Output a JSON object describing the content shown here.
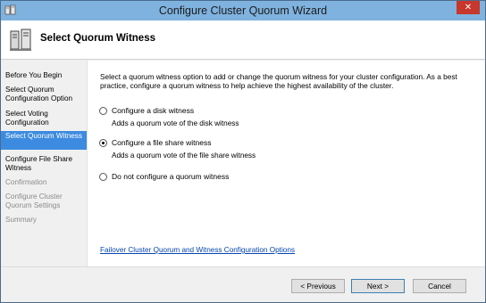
{
  "window": {
    "title": "Configure Cluster Quorum Wizard",
    "close_glyph": "✕"
  },
  "header": {
    "title": "Select Quorum Witness"
  },
  "sidebar": {
    "steps": [
      {
        "label": "Before You Begin",
        "state": "normal"
      },
      {
        "label": "Select Quorum Configuration Option",
        "state": "normal"
      },
      {
        "label": "Select Voting Configuration",
        "state": "normal"
      },
      {
        "label": "Select Quorum Witness",
        "state": "active"
      },
      {
        "label": "Configure File Share Witness",
        "state": "normal"
      },
      {
        "label": "Confirmation",
        "state": "disabled"
      },
      {
        "label": "Configure Cluster Quorum Settings",
        "state": "disabled"
      },
      {
        "label": "Summary",
        "state": "disabled"
      }
    ]
  },
  "main": {
    "intro": "Select a quorum witness option to add or change the quorum witness for your cluster configuration. As a best practice, configure a quorum witness to help achieve the highest availability of the cluster.",
    "options": [
      {
        "label": "Configure a disk witness",
        "description": "Adds a quorum vote of the disk witness",
        "checked": false
      },
      {
        "label": "Configure a file share witness",
        "description": "Adds a quorum vote of the file share witness",
        "checked": true
      },
      {
        "label": "Do not configure a quorum witness",
        "description": "",
        "checked": false
      }
    ],
    "help_link": "Failover Cluster Quorum and Witness Configuration Options"
  },
  "footer": {
    "previous_label": "< Previous",
    "next_label": "Next >",
    "cancel_label": "Cancel"
  },
  "colors": {
    "titlebar": "#7fb2df",
    "active_step": "#3c8be0",
    "close_button": "#c7372c",
    "link": "#0645ad"
  },
  "icons": {
    "app": "cluster-app-icon",
    "header": "server-cluster-icon"
  }
}
